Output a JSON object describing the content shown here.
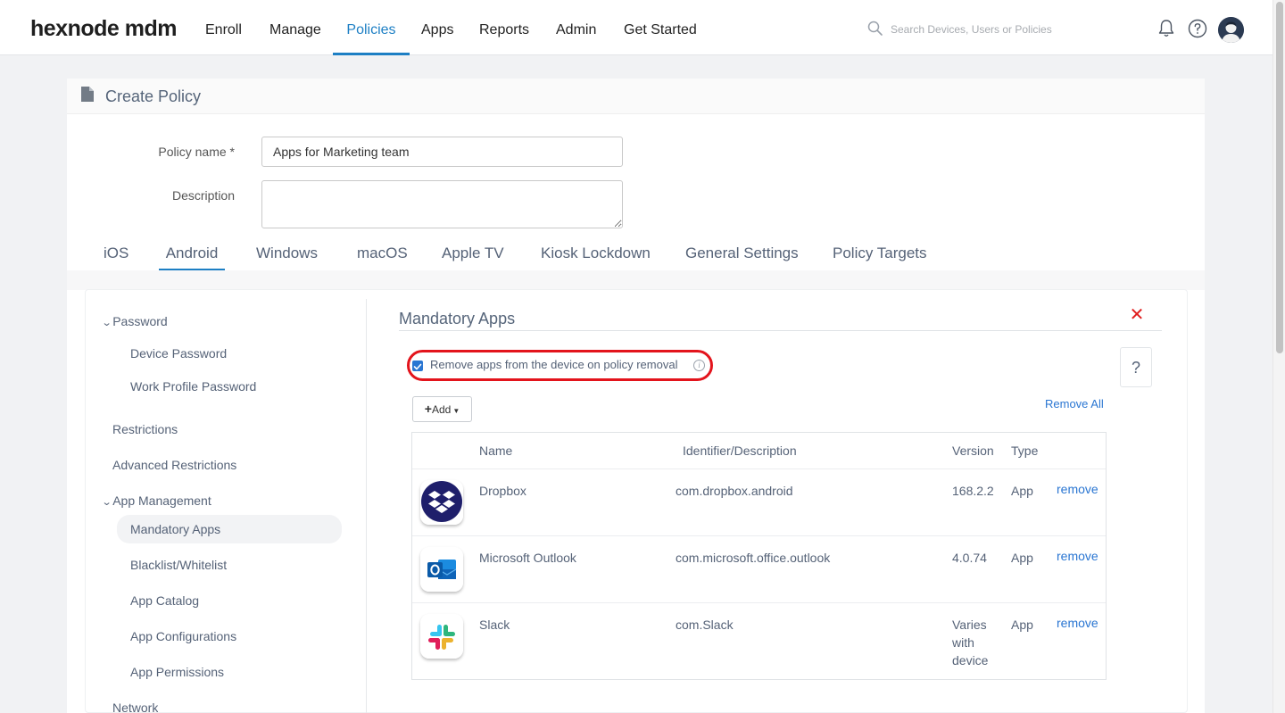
{
  "nav": {
    "logo": "hexnode mdm",
    "items": [
      "Enroll",
      "Manage",
      "Policies",
      "Apps",
      "Reports",
      "Admin",
      "Get Started"
    ],
    "active": "Policies",
    "search_placeholder": "Search Devices, Users or Policies"
  },
  "page": {
    "title": "Create Policy",
    "policy_name_label": "Policy name *",
    "policy_name_value": "Apps for Marketing team",
    "description_label": "Description",
    "description_value": ""
  },
  "tabs": [
    "iOS",
    "Android",
    "Windows",
    "macOS",
    "Apple TV",
    "Kiosk Lockdown",
    "General Settings",
    "Policy Targets"
  ],
  "active_tab": "Android",
  "sidebar": {
    "password_group": "Password",
    "device_password": "Device Password",
    "work_profile_password": "Work Profile Password",
    "restrictions": "Restrictions",
    "advanced_restrictions": "Advanced Restrictions",
    "app_management_group": "App Management",
    "mandatory_apps": "Mandatory Apps",
    "blacklist_whitelist": "Blacklist/Whitelist",
    "app_catalog": "App Catalog",
    "app_configurations": "App Configurations",
    "app_permissions": "App Permissions",
    "network": "Network"
  },
  "section": {
    "title": "Mandatory Apps",
    "remove_checkbox_label": "Remove apps from the device on policy removal",
    "remove_checkbox_checked": true,
    "add_label": "Add",
    "remove_all_label": "Remove All",
    "help_label": "?"
  },
  "table": {
    "headers": {
      "name": "Name",
      "identifier": "Identifier/Description",
      "version": "Version",
      "type": "Type"
    },
    "rows": [
      {
        "name": "Dropbox",
        "identifier": "com.dropbox.android",
        "version": "168.2.2",
        "type": "App",
        "action": "remove",
        "icon": "dropbox-icon"
      },
      {
        "name": "Microsoft Outlook",
        "identifier": "com.microsoft.office.outlook",
        "version": "4.0.74",
        "type": "App",
        "action": "remove",
        "icon": "outlook-icon"
      },
      {
        "name": "Slack",
        "identifier": "com.Slack",
        "version": "Varies with device",
        "type": "App",
        "action": "remove",
        "icon": "slack-icon"
      }
    ]
  },
  "colors": {
    "accent": "#1d7fc4",
    "link": "#2a76d2",
    "highlight": "#e3141c",
    "text_muted": "#556277"
  }
}
